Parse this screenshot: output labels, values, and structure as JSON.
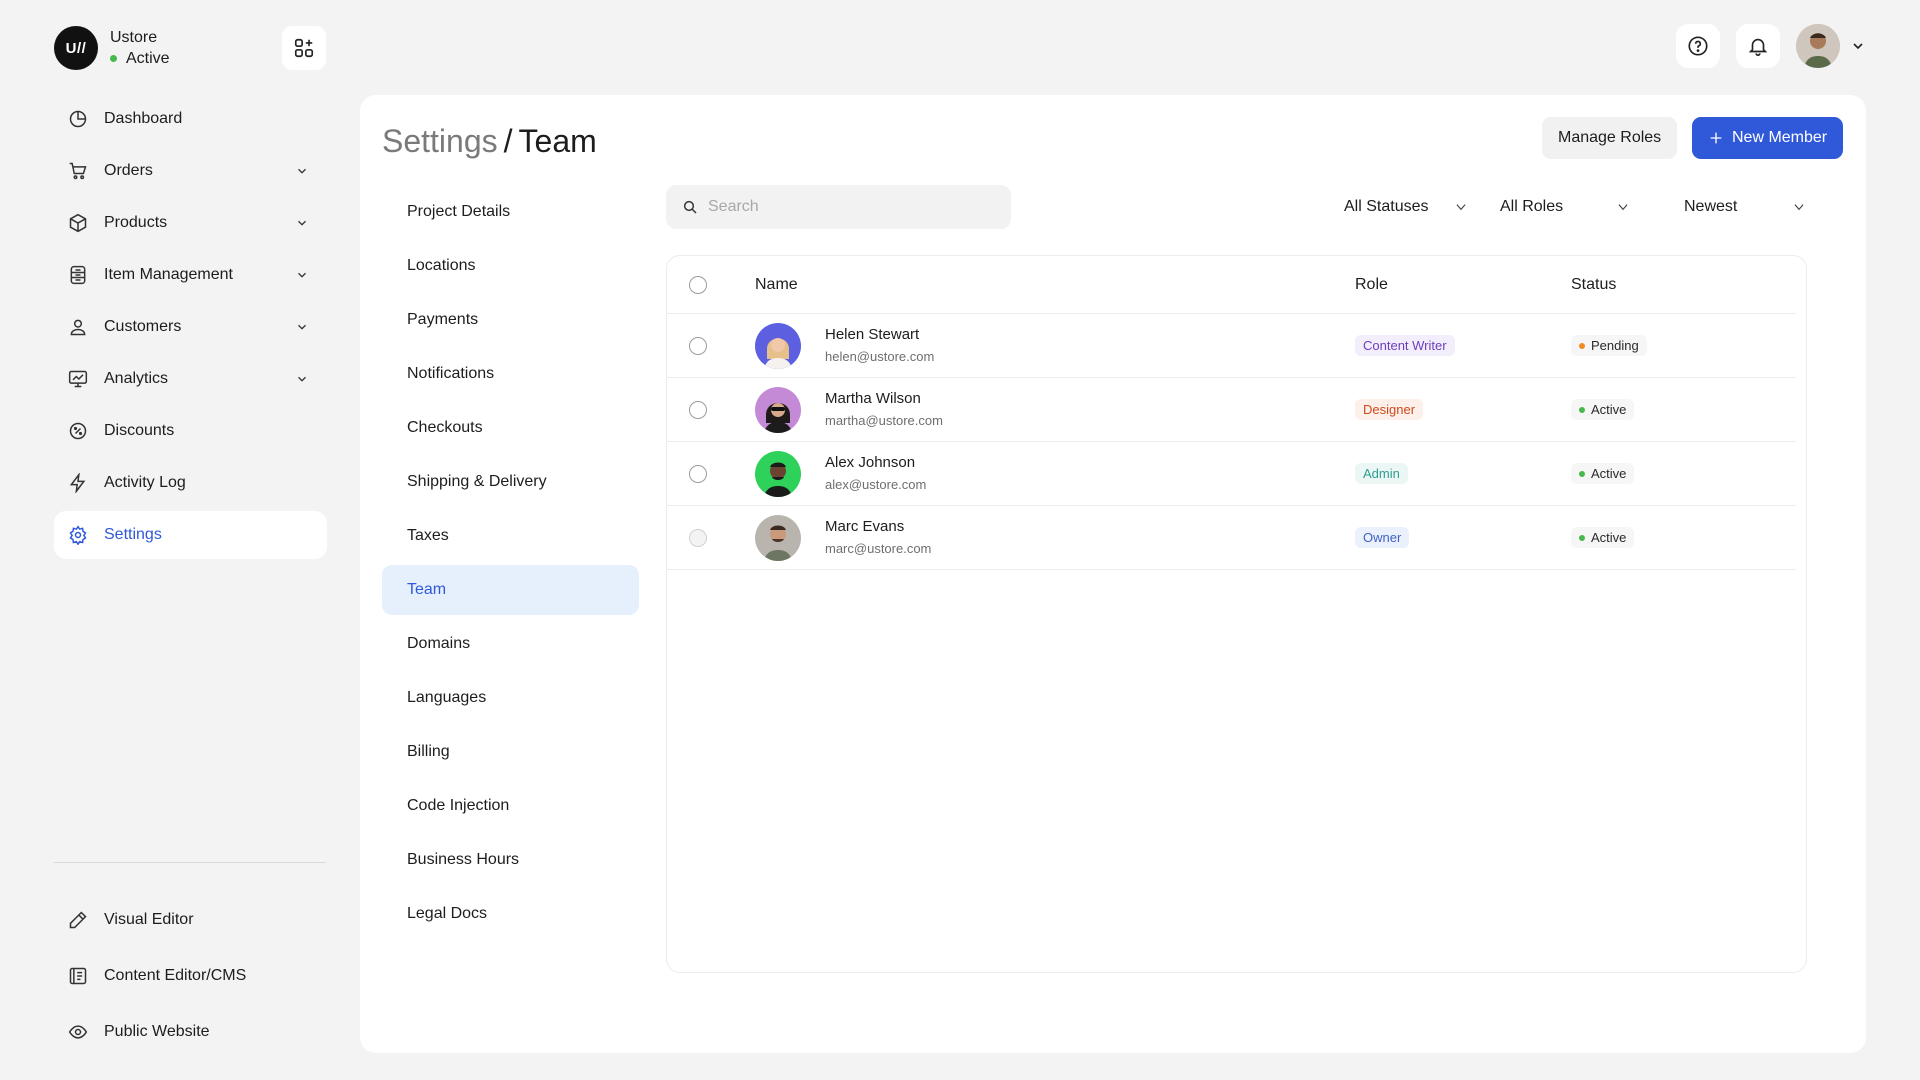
{
  "brand": {
    "logo_text": "U//",
    "name": "Ustore",
    "status": "Active"
  },
  "sidebar": {
    "items": [
      {
        "label": "Dashboard",
        "icon": "dashboard-icon",
        "has_chevron": false
      },
      {
        "label": "Orders",
        "icon": "cart-icon",
        "has_chevron": true
      },
      {
        "label": "Products",
        "icon": "box-icon",
        "has_chevron": true
      },
      {
        "label": "Item Management",
        "icon": "item-management-icon",
        "has_chevron": true
      },
      {
        "label": "Customers",
        "icon": "user-icon",
        "has_chevron": true
      },
      {
        "label": "Analytics",
        "icon": "analytics-icon",
        "has_chevron": true
      },
      {
        "label": "Discounts",
        "icon": "discount-icon",
        "has_chevron": false
      },
      {
        "label": "Activity Log",
        "icon": "lightning-icon",
        "has_chevron": false
      },
      {
        "label": "Settings",
        "icon": "gear-icon",
        "has_chevron": false,
        "active": true
      }
    ],
    "bottom_items": [
      {
        "label": "Visual Editor",
        "icon": "pencil-icon"
      },
      {
        "label": "Content Editor/CMS",
        "icon": "cms-icon"
      },
      {
        "label": "Public Website",
        "icon": "eye-icon"
      }
    ]
  },
  "page": {
    "breadcrumb_parent": "Settings",
    "breadcrumb_separator": "/",
    "breadcrumb_current": "Team",
    "manage_roles_label": "Manage Roles",
    "new_member_label": "New Member"
  },
  "settings_nav": [
    "Project Details",
    "Locations",
    "Payments",
    "Notifications",
    "Checkouts",
    "Shipping & Delivery",
    "Taxes",
    "Team",
    "Domains",
    "Languages",
    "Billing",
    "Code Injection",
    "Business Hours",
    "Legal Docs"
  ],
  "settings_nav_active": "Team",
  "search": {
    "placeholder": "Search",
    "value": ""
  },
  "filters": {
    "status": "All Statuses",
    "roles": "All Roles",
    "sort": "Newest"
  },
  "table": {
    "columns": {
      "name": "Name",
      "role": "Role",
      "status": "Status"
    },
    "rows": [
      {
        "name": "Helen Stewart",
        "email": "helen@ustore.com",
        "role": "Content Writer",
        "role_color": "purple",
        "status": "Pending",
        "status_color": "#f08a24",
        "avatar_bg": "#5b5fe0"
      },
      {
        "name": "Martha Wilson",
        "email": "martha@ustore.com",
        "role": "Designer",
        "role_color": "orange",
        "status": "Active",
        "status_color": "#46b94c",
        "avatar_bg": "#c58ad6"
      },
      {
        "name": "Alex Johnson",
        "email": "alex@ustore.com",
        "role": "Admin",
        "role_color": "teal",
        "status": "Active",
        "status_color": "#46b94c",
        "avatar_bg": "#2ed15a"
      },
      {
        "name": "Marc Evans",
        "email": "marc@ustore.com",
        "role": "Owner",
        "role_color": "blue",
        "status": "Active",
        "status_color": "#46b94c",
        "avatar_bg": "#b9b4ae"
      }
    ]
  },
  "colors": {
    "accent": "#2f59d9",
    "active_bg": "#e6f0fd",
    "page_bg": "#f3f3f3"
  }
}
